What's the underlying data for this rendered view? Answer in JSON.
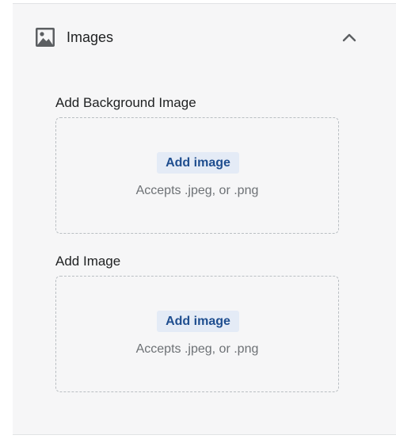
{
  "section": {
    "title": "Images",
    "icon": "image-icon",
    "collapse_icon": "chevron-up-icon"
  },
  "fields": [
    {
      "label": "Add Background Image",
      "button_label": "Add image",
      "accepts_text": "Accepts .jpeg, or .png"
    },
    {
      "label": "Add Image",
      "button_label": "Add image",
      "accepts_text": "Accepts .jpeg, or .png"
    }
  ],
  "colors": {
    "panel_background": "#f6f6f7",
    "button_background": "#e4ebf6",
    "button_text": "#1f4e8f",
    "muted_text": "#6d7175",
    "icon": "#5c5f62"
  }
}
